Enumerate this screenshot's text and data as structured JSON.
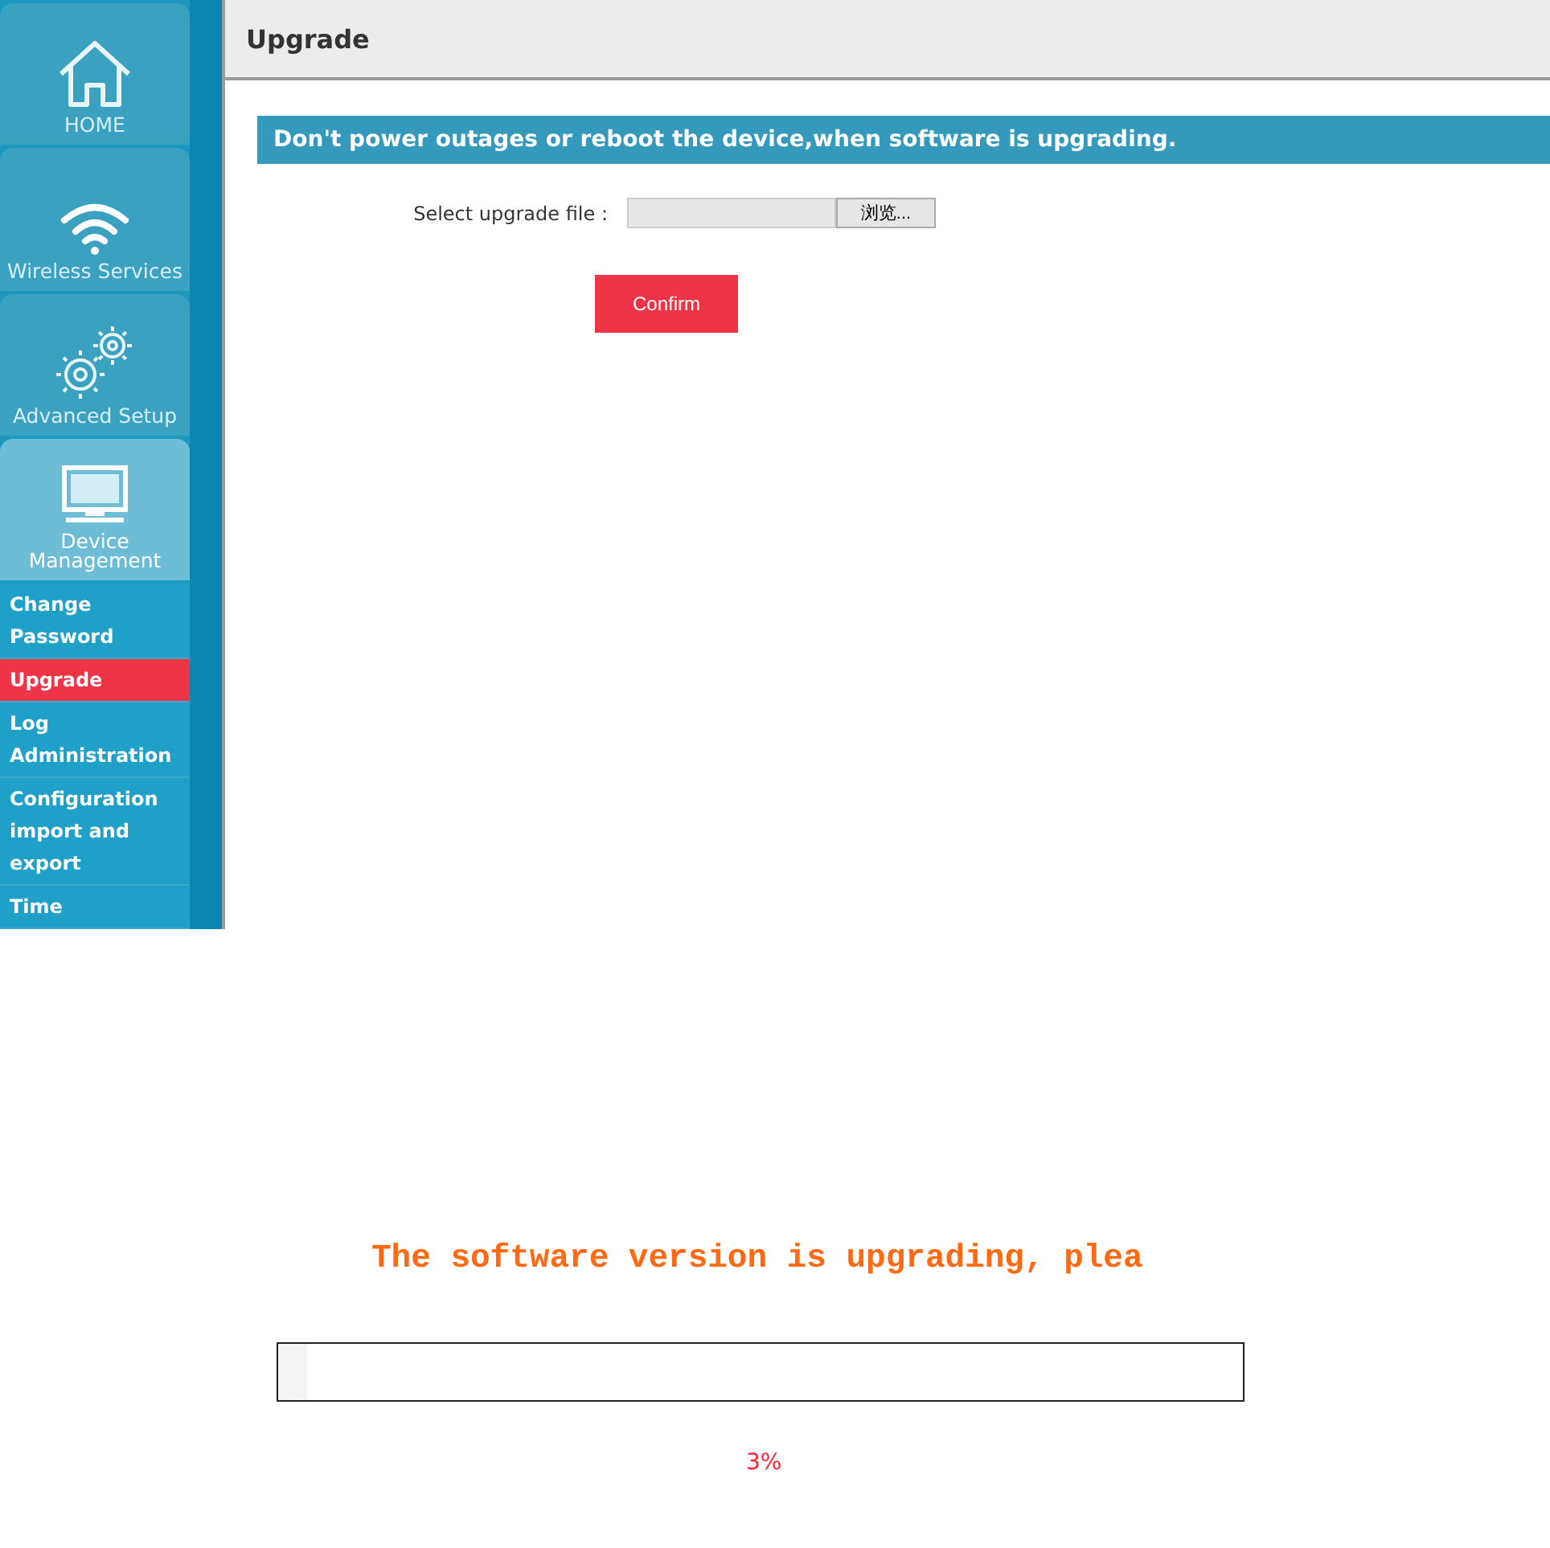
{
  "sidebar": {
    "tiles": [
      {
        "label": "HOME",
        "kind": "home",
        "selected": false
      },
      {
        "label": "Wireless Services",
        "kind": "wifi",
        "selected": false
      },
      {
        "label": "Advanced Setup",
        "kind": "gears",
        "selected": false
      },
      {
        "label": "Device Management",
        "kind": "monitor",
        "selected": true
      }
    ],
    "items": [
      {
        "label": "Change Password",
        "selected": false
      },
      {
        "label": "Upgrade",
        "selected": true
      },
      {
        "label": "Log Administration",
        "selected": false
      },
      {
        "label": "Configuration import and export",
        "selected": false
      },
      {
        "label": "Time",
        "selected": false
      }
    ]
  },
  "page": {
    "title": "Upgrade",
    "warning": "Don't power outages or reboot the device,when software is upgrading.",
    "file_label": "Select upgrade file :",
    "browse_button": "浏览...",
    "confirm_button": "Confirm"
  },
  "progress": {
    "message": "The software version is upgrading, plea",
    "level": 0.03,
    "reading": "3%"
  }
}
